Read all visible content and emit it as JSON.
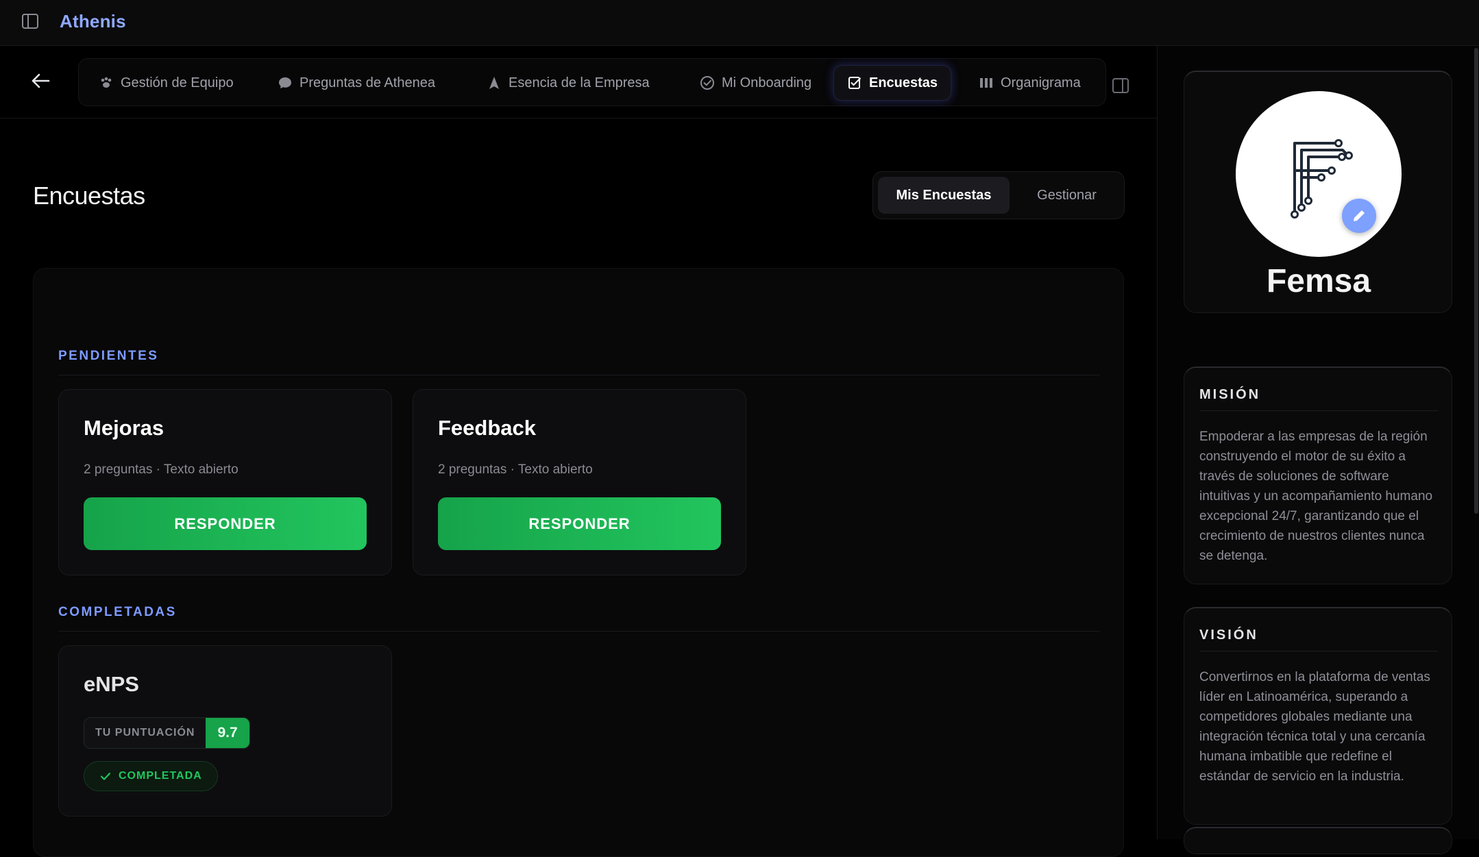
{
  "app": {
    "brand": "Athenis"
  },
  "nav": {
    "tabs": [
      {
        "label": "Gestión de Equipo",
        "icon": "paw-icon"
      },
      {
        "label": "Preguntas de Athenea",
        "icon": "chat-bubble-icon"
      },
      {
        "label": "Esencia de la Empresa",
        "icon": "navigation-arrow-icon"
      },
      {
        "label": "Mi Onboarding",
        "icon": "check-circle-icon"
      },
      {
        "label": "Encuestas",
        "icon": "checklist-icon",
        "active": true
      },
      {
        "label": "Organigrama",
        "icon": "columns-icon"
      }
    ]
  },
  "page": {
    "title": "Encuestas",
    "segment": {
      "active": "Mis Encuestas",
      "inactive": "Gestionar"
    }
  },
  "surveys": {
    "pending_label": "PENDIENTES",
    "completed_label": "COMPLETADAS",
    "pending": [
      {
        "title": "Mejoras",
        "meta": "2 preguntas · Texto abierto",
        "action": "RESPONDER"
      },
      {
        "title": "Feedback",
        "meta": "2 preguntas · Texto abierto",
        "action": "RESPONDER"
      }
    ],
    "completed": [
      {
        "title": "eNPS",
        "score_label": "TU PUNTUACIÓN",
        "score": "9.7",
        "status": "COMPLETADA"
      }
    ]
  },
  "company": {
    "name": "Femsa",
    "mission": {
      "title": "MISIÓN",
      "text": "Empoderar a las empresas de la región construyendo el motor de su éxito a través de soluciones de software intuitivas y un acompañamiento humano excepcional 24/7, garantizando que el crecimiento de nuestros clientes nunca se detenga."
    },
    "vision": {
      "title": "VISIÓN",
      "text": "Convertirnos en la plataforma de ventas líder en Latinoamérica, superando a competidores globales mediante una integración técnica total y una cercanía humana imbatible que redefine el estándar de servicio en la industria."
    }
  },
  "colors": {
    "accent": "#7d9bff",
    "brand": "#8fa9ff",
    "success": "#22c55e",
    "success_dark": "#16a34a",
    "background": "#000000"
  }
}
